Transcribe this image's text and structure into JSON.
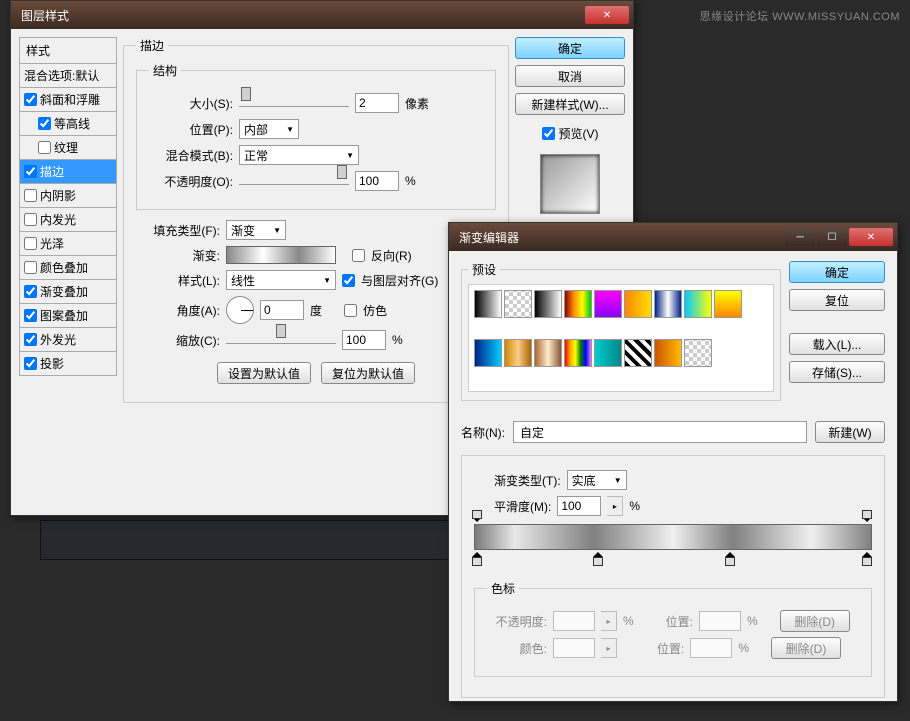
{
  "watermark": "思缘设计论坛 WWW.MISSYUAN.COM",
  "layer_dialog": {
    "title": "图层样式",
    "styles_header": "样式",
    "blending_default": "混合选项:默认",
    "items": [
      {
        "label": "斜面和浮雕",
        "checked": true
      },
      {
        "label": "等高线",
        "checked": true,
        "sub": true
      },
      {
        "label": "纹理",
        "checked": false,
        "sub": true
      },
      {
        "label": "描边",
        "checked": true,
        "selected": true
      },
      {
        "label": "内阴影",
        "checked": false
      },
      {
        "label": "内发光",
        "checked": false
      },
      {
        "label": "光泽",
        "checked": false
      },
      {
        "label": "颜色叠加",
        "checked": false
      },
      {
        "label": "渐变叠加",
        "checked": true
      },
      {
        "label": "图案叠加",
        "checked": true
      },
      {
        "label": "外发光",
        "checked": true
      },
      {
        "label": "投影",
        "checked": true
      }
    ],
    "stroke": {
      "legend": "描边",
      "structure_legend": "结构",
      "size_label": "大小(S):",
      "size_value": "2",
      "size_unit": "像素",
      "position_label": "位置(P):",
      "position_value": "内部",
      "blend_label": "混合模式(B):",
      "blend_value": "正常",
      "opacity_label": "不透明度(O):",
      "opacity_value": "100",
      "opacity_unit": "%",
      "fill_type_label": "填充类型(F):",
      "fill_type_value": "渐变",
      "gradient_label": "渐变:",
      "reverse_label": "反向(R)",
      "style_label": "样式(L):",
      "style_value": "线性",
      "align_label": "与图层对齐(G)",
      "angle_label": "角度(A):",
      "angle_value": "0",
      "angle_unit": "度",
      "dither_label": "仿色",
      "scale_label": "缩放(C):",
      "scale_value": "100",
      "scale_unit": "%",
      "set_default": "设置为默认值",
      "reset_default": "复位为默认值"
    },
    "buttons": {
      "ok": "确定",
      "cancel": "取消",
      "new_style": "新建样式(W)...",
      "preview": "预览(V)"
    }
  },
  "gradient_editor": {
    "title": "渐变编辑器",
    "presets_legend": "预设",
    "buttons": {
      "ok": "确定",
      "reset": "复位",
      "load": "载入(L)...",
      "save": "存储(S)..."
    },
    "name_label": "名称(N):",
    "name_value": "自定",
    "new_button": "新建(W)",
    "type_label": "渐变类型(T):",
    "type_value": "实底",
    "smoothness_label": "平滑度(M):",
    "smoothness_value": "100",
    "smoothness_unit": "%",
    "color_stops": {
      "legend": "色标",
      "opacity_label": "不透明度:",
      "percent": "%",
      "position_label": "位置:",
      "delete_label": "删除(D)",
      "color_label": "颜色:"
    },
    "swatch_colors": [
      "linear-gradient(to right,#000,#fff)",
      "repeating-conic-gradient(#ccc 0 25%,#fff 0 50%) 0/8px 8px",
      "linear-gradient(to right,#000,#fff)",
      "linear-gradient(to right,#800,#f80,#ff0,#0c0)",
      "linear-gradient(to bottom,#f0f,#80f)",
      "linear-gradient(to right,#f80,#fd0)",
      "linear-gradient(to right,#028,#fff,#028)",
      "linear-gradient(to right,#0cf,#ff0)",
      "linear-gradient(to bottom,#ff0,#f80)",
      "linear-gradient(to right,#028,#0cf)",
      "linear-gradient(to right,#c80,#fc8,#a60)",
      "linear-gradient(to right,#a63,#fec,#853)",
      "linear-gradient(to right,red,orange,yellow,green,blue,violet)",
      "linear-gradient(to right,#0cc,#088)",
      "repeating-linear-gradient(45deg,#000 0 4px,#fff 4px 8px)",
      "linear-gradient(to right,#c50,#fb0)",
      "repeating-conic-gradient(#ccc 0 25%,#fff 0 50%) 0/8px 8px"
    ]
  }
}
